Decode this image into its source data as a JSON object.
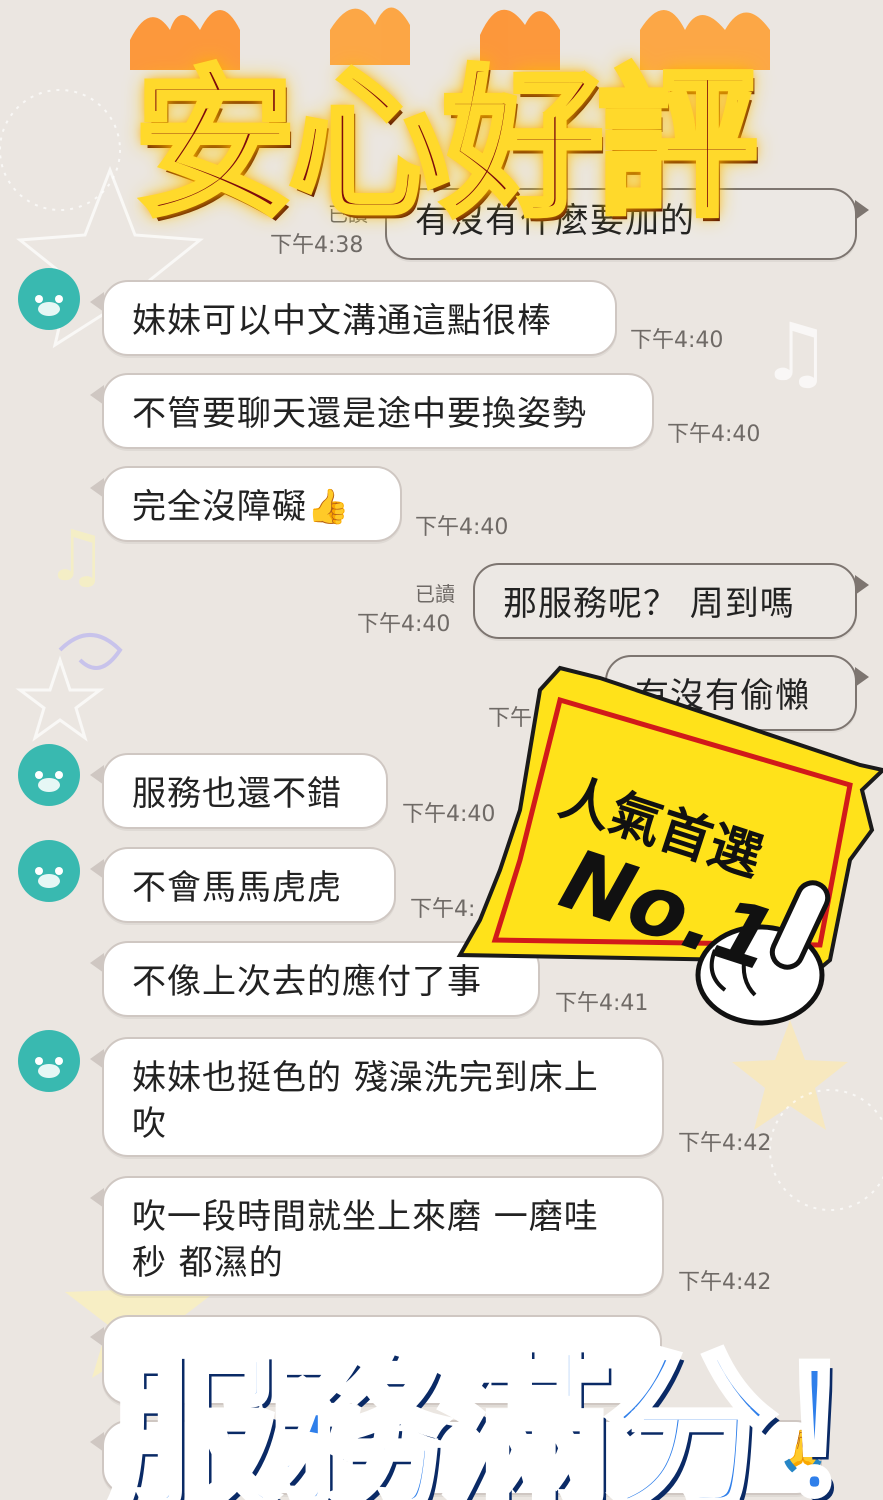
{
  "banner": {
    "top_title": "安心好評",
    "bottom_title": "服務滿分！",
    "badge_line1": "人氣首選",
    "badge_line2": "No.1"
  },
  "colors": {
    "background": "#ebe6e1",
    "incoming_bubble": "#ffffff",
    "outgoing_bubble": "#ece8e4",
    "avatar": "#39b9b0",
    "top_title": "#7e0c0c",
    "bottom_title": "#2f7fea",
    "badge": "#ffe21a"
  },
  "messages": {
    "m0": {
      "text": "有沒有什麼要加的",
      "time": "下午4:38",
      "read": "已讀"
    },
    "m1": {
      "text": "妹妹可以中文溝通這點很棒",
      "time": "下午4:40"
    },
    "m2": {
      "text": "不管要聊天還是途中要換姿勢",
      "time": "下午4:40"
    },
    "m3": {
      "text": "完全沒障礙👍",
      "time": "下午4:40"
    },
    "m4": {
      "text": "那服務呢？ 周到嗎",
      "time": "下午4:40",
      "read": "已讀"
    },
    "m5": {
      "text": "有沒有偷懶",
      "time": "下午",
      "read": "已"
    },
    "m6": {
      "text": "服務也還不錯",
      "time": "下午4:40"
    },
    "m7": {
      "text": "不會馬馬虎虎",
      "time": "下午4:"
    },
    "m8": {
      "text": "不像上次去的應付了事",
      "time": "下午4:41"
    },
    "m9": {
      "text": "妹妹也挺色的 殘澡洗完到床上\n吹",
      "time": "下午4:42"
    },
    "m10": {
      "text": "吹一段時間就坐上來磨 一磨哇\n秒 都濕的",
      "time": "下午4:42"
    },
    "m11": {
      "emoji": "🙏"
    }
  }
}
